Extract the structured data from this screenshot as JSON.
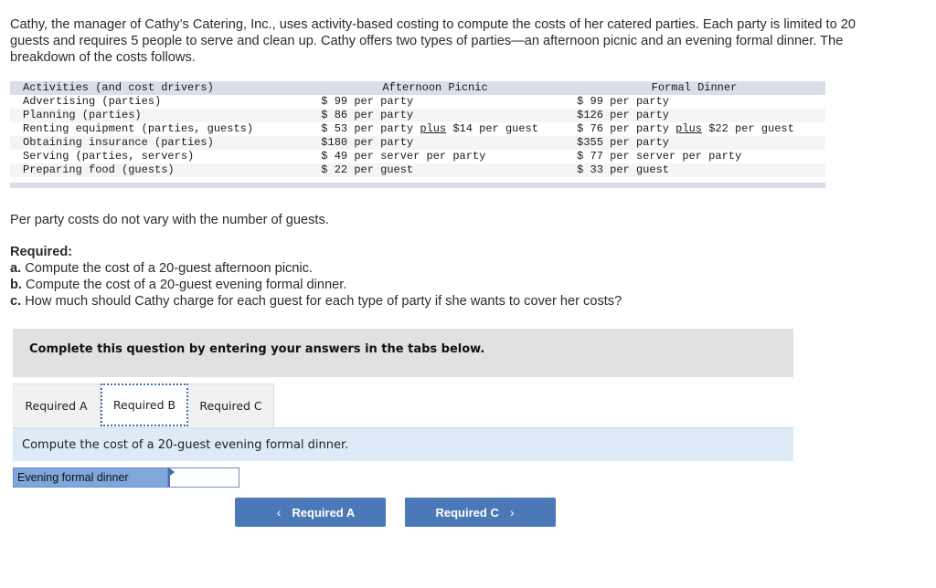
{
  "intro": "Cathy, the manager of Cathy’s Catering, Inc., uses activity-based costing to compute the costs of her catered parties. Each party is limited to 20 guests and requires 5 people to serve and clean up. Cathy offers two types of parties—an afternoon picnic and an evening formal dinner. The breakdown of the costs follows.",
  "table": {
    "headers": [
      "Activities (and cost drivers)",
      "Afternoon Picnic",
      "Formal Dinner"
    ],
    "rows": [
      {
        "activity": "Advertising (parties)",
        "picnic": {
          "amt": "$ 99",
          "unit": "per party",
          "plus": "",
          "extra": ""
        },
        "dinner": {
          "amt": "$ 99",
          "unit": "per party",
          "plus": "",
          "extra": ""
        }
      },
      {
        "activity": "Planning (parties)",
        "picnic": {
          "amt": "$ 86",
          "unit": "per party",
          "plus": "",
          "extra": ""
        },
        "dinner": {
          "amt": "$126",
          "unit": "per party",
          "plus": "",
          "extra": ""
        }
      },
      {
        "activity": "Renting equipment (parties, guests)",
        "picnic": {
          "amt": "$ 53",
          "unit": "per party",
          "plus": "plus",
          "extra": "$14 per guest"
        },
        "dinner": {
          "amt": "$ 76",
          "unit": "per party",
          "plus": "plus",
          "extra": "$22 per guest"
        }
      },
      {
        "activity": "Obtaining insurance (parties)",
        "picnic": {
          "amt": "$180",
          "unit": "per party",
          "plus": "",
          "extra": ""
        },
        "dinner": {
          "amt": "$355",
          "unit": "per party",
          "plus": "",
          "extra": ""
        }
      },
      {
        "activity": "Serving (parties, servers)",
        "picnic": {
          "amt": "$ 49",
          "unit": "per server per party",
          "plus": "",
          "extra": ""
        },
        "dinner": {
          "amt": "$ 77",
          "unit": "per server per party",
          "plus": "",
          "extra": ""
        }
      },
      {
        "activity": "Preparing food (guests)",
        "picnic": {
          "amt": "$ 22",
          "unit": "per guest",
          "plus": "",
          "extra": ""
        },
        "dinner": {
          "amt": "$ 33",
          "unit": "per guest",
          "plus": "",
          "extra": ""
        }
      }
    ]
  },
  "note": "Per party costs do not vary with the number of guests.",
  "required": {
    "heading": "Required:",
    "items": [
      {
        "letter": "a.",
        "text": " Compute the cost of a 20-guest afternoon picnic."
      },
      {
        "letter": "b.",
        "text": " Compute the cost of a 20-guest evening formal dinner."
      },
      {
        "letter": "c.",
        "text": " How much should Cathy charge for each guest for each type of party if she wants to cover her costs?"
      }
    ]
  },
  "instruction": "Complete this question by entering your answers in the tabs below.",
  "tabs": [
    {
      "label": "Required A",
      "active": false
    },
    {
      "label": "Required B",
      "active": true
    },
    {
      "label": "Required C",
      "active": false
    }
  ],
  "prompt": "Compute the cost of a 20-guest evening formal dinner.",
  "answer": {
    "label": "Evening formal dinner",
    "value": ""
  },
  "nav": {
    "prev_label": "Required A",
    "next_label": "Required C",
    "prev_icon": "‹",
    "next_icon": "›"
  },
  "colors": {
    "accent": "#4b78b7",
    "tab_focus": "#3f6db3",
    "label_bg": "#7fa7dc",
    "prompt_bg": "#deebf7"
  }
}
